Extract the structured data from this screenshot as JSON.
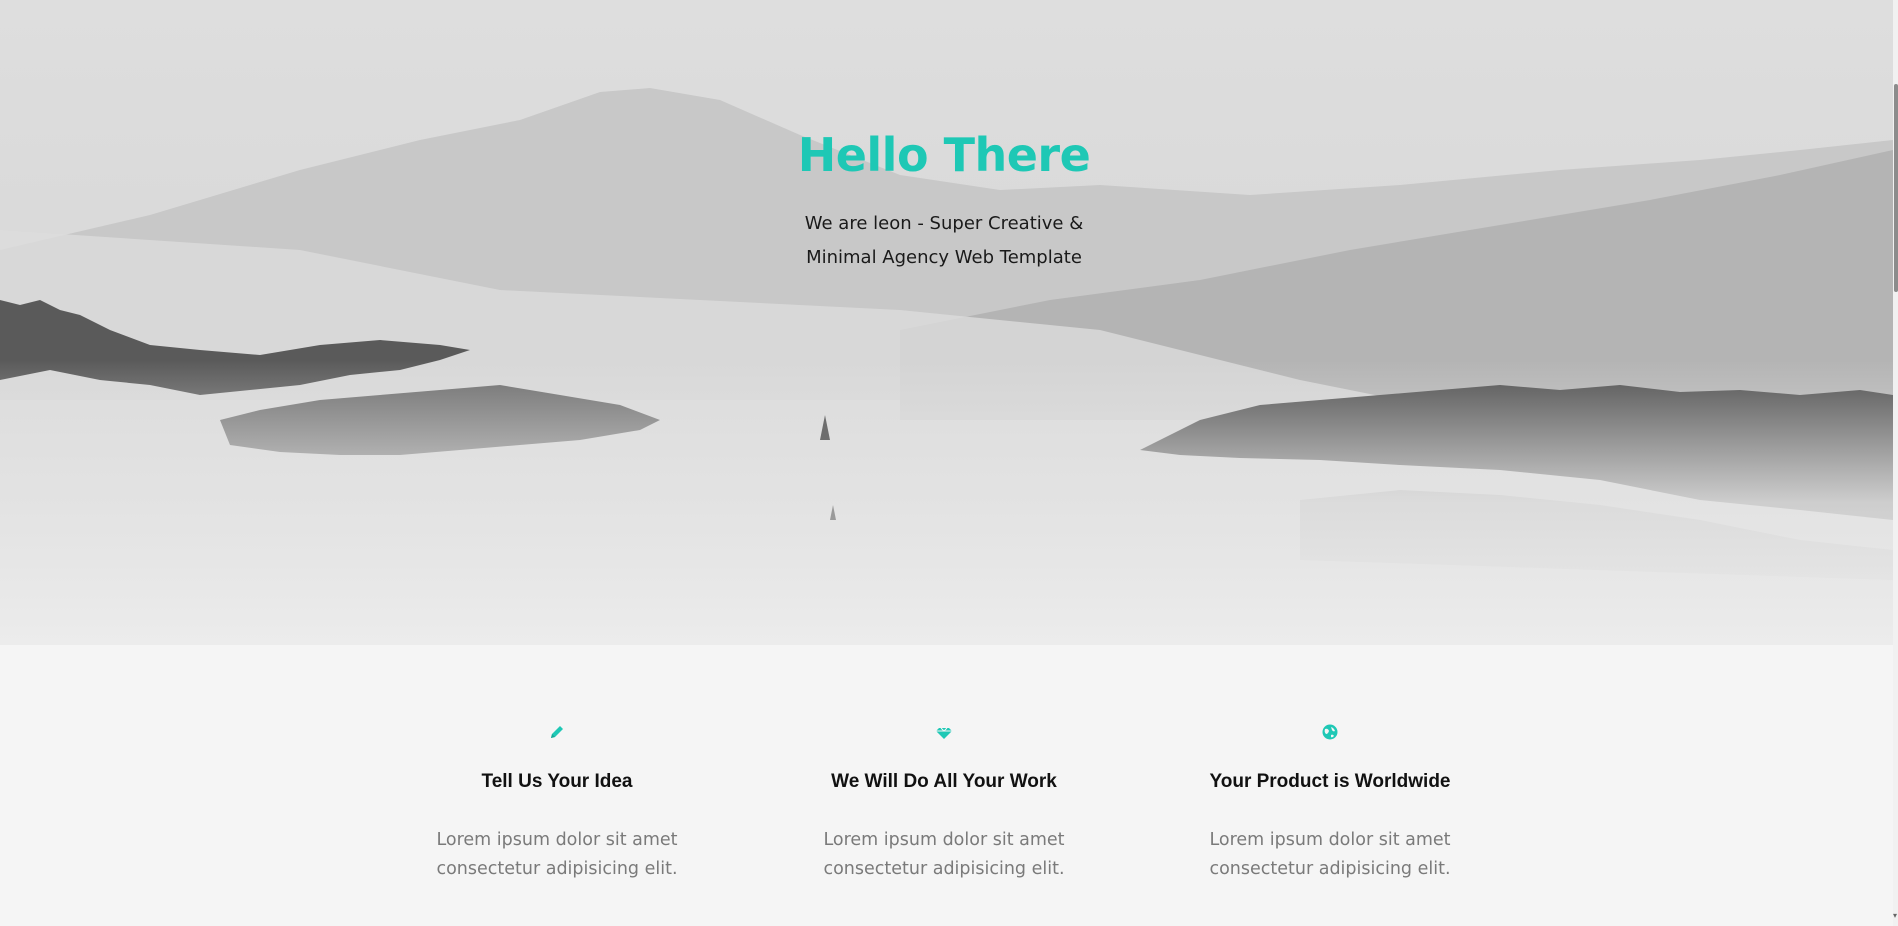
{
  "hero": {
    "title": "Hello There",
    "subtitle_line1": "We are leon - Super Creative &",
    "subtitle_line2": "Minimal Agency Web Template",
    "background_image": "misty-mountain-forest-image"
  },
  "features": [
    {
      "icon": "pencil-icon",
      "title": "Tell Us Your Idea",
      "text_line1": "Lorem ipsum dolor sit amet",
      "text_line2": "consectetur adipisicing elit."
    },
    {
      "icon": "diamond-icon",
      "title": "We Will Do All Your Work",
      "text_line1": "Lorem ipsum dolor sit amet",
      "text_line2": "consectetur adipisicing elit."
    },
    {
      "icon": "globe-icon",
      "title": "Your Product is Worldwide",
      "text_line1": "Lorem ipsum dolor sit amet",
      "text_line2": "consectetur adipisicing elit."
    }
  ],
  "colors": {
    "accent": "#1ec8b5",
    "heading": "#111111",
    "body_text": "#7a7a7a",
    "section_bg": "#f5f5f5"
  }
}
